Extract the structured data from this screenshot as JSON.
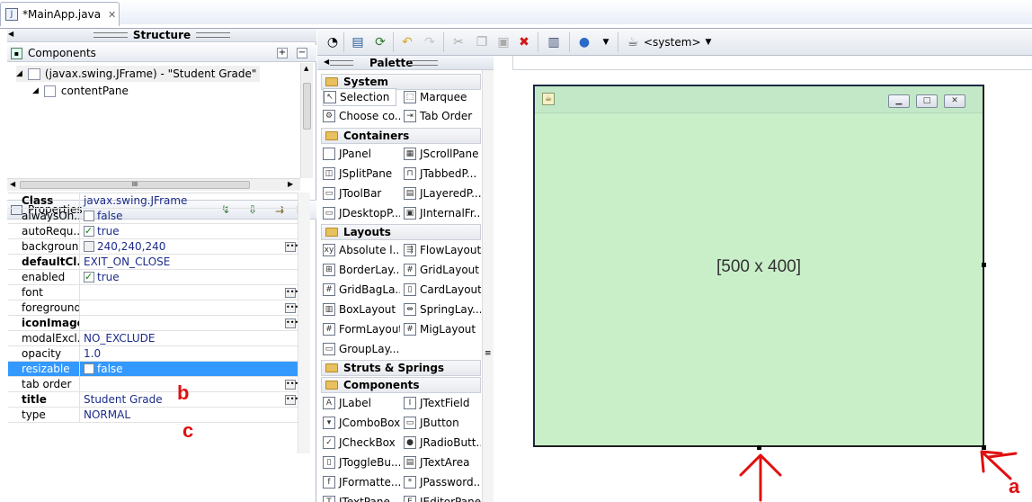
{
  "tab": {
    "label": "*MainApp.java",
    "close": "✕"
  },
  "structure": {
    "title": "Structure",
    "components_label": "Components",
    "tree": [
      {
        "label": "(javax.swing.JFrame) - \"Student Grade\""
      },
      {
        "label": "contentPane"
      }
    ],
    "scroll_h_grip": "III"
  },
  "properties": {
    "title": "Properties",
    "rows": [
      {
        "key": "Class",
        "value": "javax.swing.JFrame",
        "bold": true
      },
      {
        "key": "alwaysOn...",
        "value": "false",
        "checkbox": "off"
      },
      {
        "key": "autoRequ...",
        "value": "true",
        "checkbox": "on"
      },
      {
        "key": "background",
        "value": "240,240,240",
        "swatch": "#f0f0f0",
        "ellipsis": true
      },
      {
        "key": "defaultCl...",
        "value": "EXIT_ON_CLOSE",
        "bold": true
      },
      {
        "key": "enabled",
        "value": "true",
        "checkbox": "on"
      },
      {
        "key": "font",
        "value": "",
        "ellipsis": true
      },
      {
        "key": "foreground",
        "value": "",
        "ellipsis": true
      },
      {
        "key": "iconImage",
        "value": "",
        "bold": true,
        "ellipsis": true
      },
      {
        "key": "modalExcl...",
        "value": "NO_EXCLUDE"
      },
      {
        "key": "opacity",
        "value": "1.0"
      },
      {
        "key": "resizable",
        "value": "false",
        "checkbox": "off",
        "selected": true
      },
      {
        "key": "tab order",
        "value": "",
        "ellipsis": true
      },
      {
        "key": "title",
        "value": "Student Grade",
        "bold": true,
        "ellipsis": true
      },
      {
        "key": "type",
        "value": "NORMAL"
      }
    ]
  },
  "toolbar": {
    "system_label": "<system>"
  },
  "palette": {
    "title": "Palette",
    "categories": {
      "system": "System",
      "containers": "Containers",
      "layouts": "Layouts",
      "struts": "Struts & Springs",
      "components": "Components"
    },
    "items": {
      "selection": "Selection",
      "marquee": "Marquee",
      "choose": "Choose co...",
      "taborder": "Tab Order",
      "jpanel": "JPanel",
      "jscrollpane": "JScrollPane",
      "jsplitpane": "JSplitPane",
      "jtabbedpane": "JTabbedP...",
      "jtoolbar": "JToolBar",
      "jlayeredpane": "JLayeredP...",
      "jdesktoppane": "JDesktopP...",
      "jinternalframe": "JInternalFr...",
      "absolute": "Absolute l...",
      "flowlayout": "FlowLayout",
      "borderlayout": "BorderLay...",
      "gridlayout": "GridLayout",
      "gridbaglayout": "GridBagLa...",
      "cardlayout": "CardLayout",
      "boxlayout": "BoxLayout",
      "springlayout": "SpringLay...",
      "formlayout": "FormLayout",
      "miglayout": "MigLayout",
      "grouplayout": "GroupLay...",
      "jlabel": "JLabel",
      "jtextfield": "JTextField",
      "jcombobox": "JComboBox",
      "jbutton": "JButton",
      "jcheckbox": "JCheckBox",
      "jradiobutton": "JRadioButt...",
      "jtogglebutton": "JToggleBu...",
      "jtextarea": "JTextArea",
      "jformattedtextfield": "JFormatte...",
      "jpasswordfield": "JPassword...",
      "jtextpane": "JTextPane",
      "jeditorpane": "JEditorPane"
    }
  },
  "designer": {
    "size_caption": "[500 x 400]"
  },
  "annotations": {
    "a": "a",
    "b": "b",
    "c": "c"
  },
  "colors": {
    "selection": "#3399ff",
    "frame_bg": "#c9efc9",
    "annotation": "#e01010"
  }
}
